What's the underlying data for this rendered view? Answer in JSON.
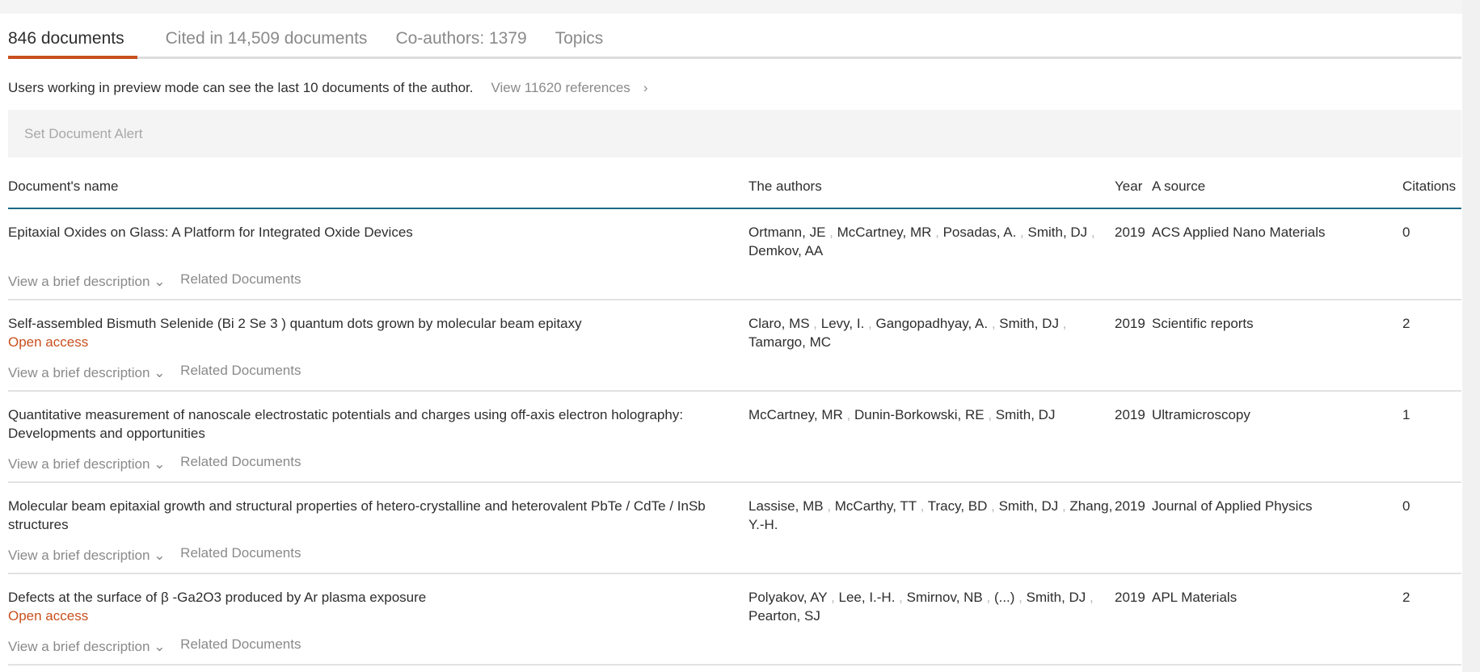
{
  "tabs": [
    {
      "label": "846 documents",
      "active": true
    },
    {
      "label": "Cited in 14,509 documents"
    },
    {
      "label": "Co-authors: 1379"
    },
    {
      "label": "Topics"
    }
  ],
  "info": {
    "text": "Users working in preview mode can see the last 10 documents of the author.",
    "references_link": "View 11620 references",
    "chevron": "›"
  },
  "alert_button": "Set Document Alert",
  "table": {
    "headers": {
      "name": "Document's name",
      "authors": "The authors",
      "year": "Year",
      "source": "A source",
      "citations": "Citations"
    },
    "actions": {
      "description": "View a brief description",
      "description_chevron": "⌄",
      "related": "Related Documents"
    },
    "rows": [
      {
        "title": "Epitaxial Oxides on Glass: A Platform for Integrated Oxide Devices",
        "open_access": null,
        "authors": [
          "Ortmann, JE",
          "McCartney, MR",
          "Posadas, A.",
          "Smith, DJ",
          "Demkov, AA"
        ],
        "year": "2019",
        "source": "ACS Applied Nano Materials",
        "citations": "0"
      },
      {
        "title": "Self-assembled Bismuth Selenide (Bi 2 Se 3 ) quantum dots grown by molecular beam epitaxy",
        "open_access": "Open access",
        "authors": [
          "Claro, MS",
          "Levy, I.",
          "Gangopadhyay, A.",
          "Smith, DJ",
          "Tamargo, MC"
        ],
        "year": "2019",
        "source": "Scientific reports",
        "citations": "2"
      },
      {
        "title": "Quantitative measurement of nanoscale electrostatic potentials and charges using off-axis electron holography: Developments and opportunities",
        "open_access": null,
        "authors": [
          "McCartney, MR",
          "Dunin-Borkowski, RE",
          "Smith, DJ"
        ],
        "year": "2019",
        "source": "Ultramicroscopy",
        "citations": "1"
      },
      {
        "title": "Molecular beam epitaxial growth and structural properties of hetero-crystalline and heterovalent PbTe / CdTe / InSb structures",
        "open_access": null,
        "authors": [
          "Lassise, MB",
          "McCarthy, TT",
          "Tracy, BD",
          "Smith, DJ",
          "Zhang, Y.-H."
        ],
        "year": "2019",
        "source": "Journal of Applied Physics",
        "citations": "0"
      },
      {
        "title": "Defects at the surface of β -Ga2O3 produced by Ar plasma exposure",
        "open_access": "Open access",
        "authors": [
          "Polyakov, AY",
          "Lee, I.-H.",
          "Smirnov, NB",
          "(...)",
          "Smith, DJ",
          "Pearton, SJ"
        ],
        "year": "2019",
        "source": "APL Materials",
        "citations": "2"
      }
    ]
  },
  "colors": {
    "accent": "#c8501e",
    "header_rule": "#1a6a88"
  }
}
